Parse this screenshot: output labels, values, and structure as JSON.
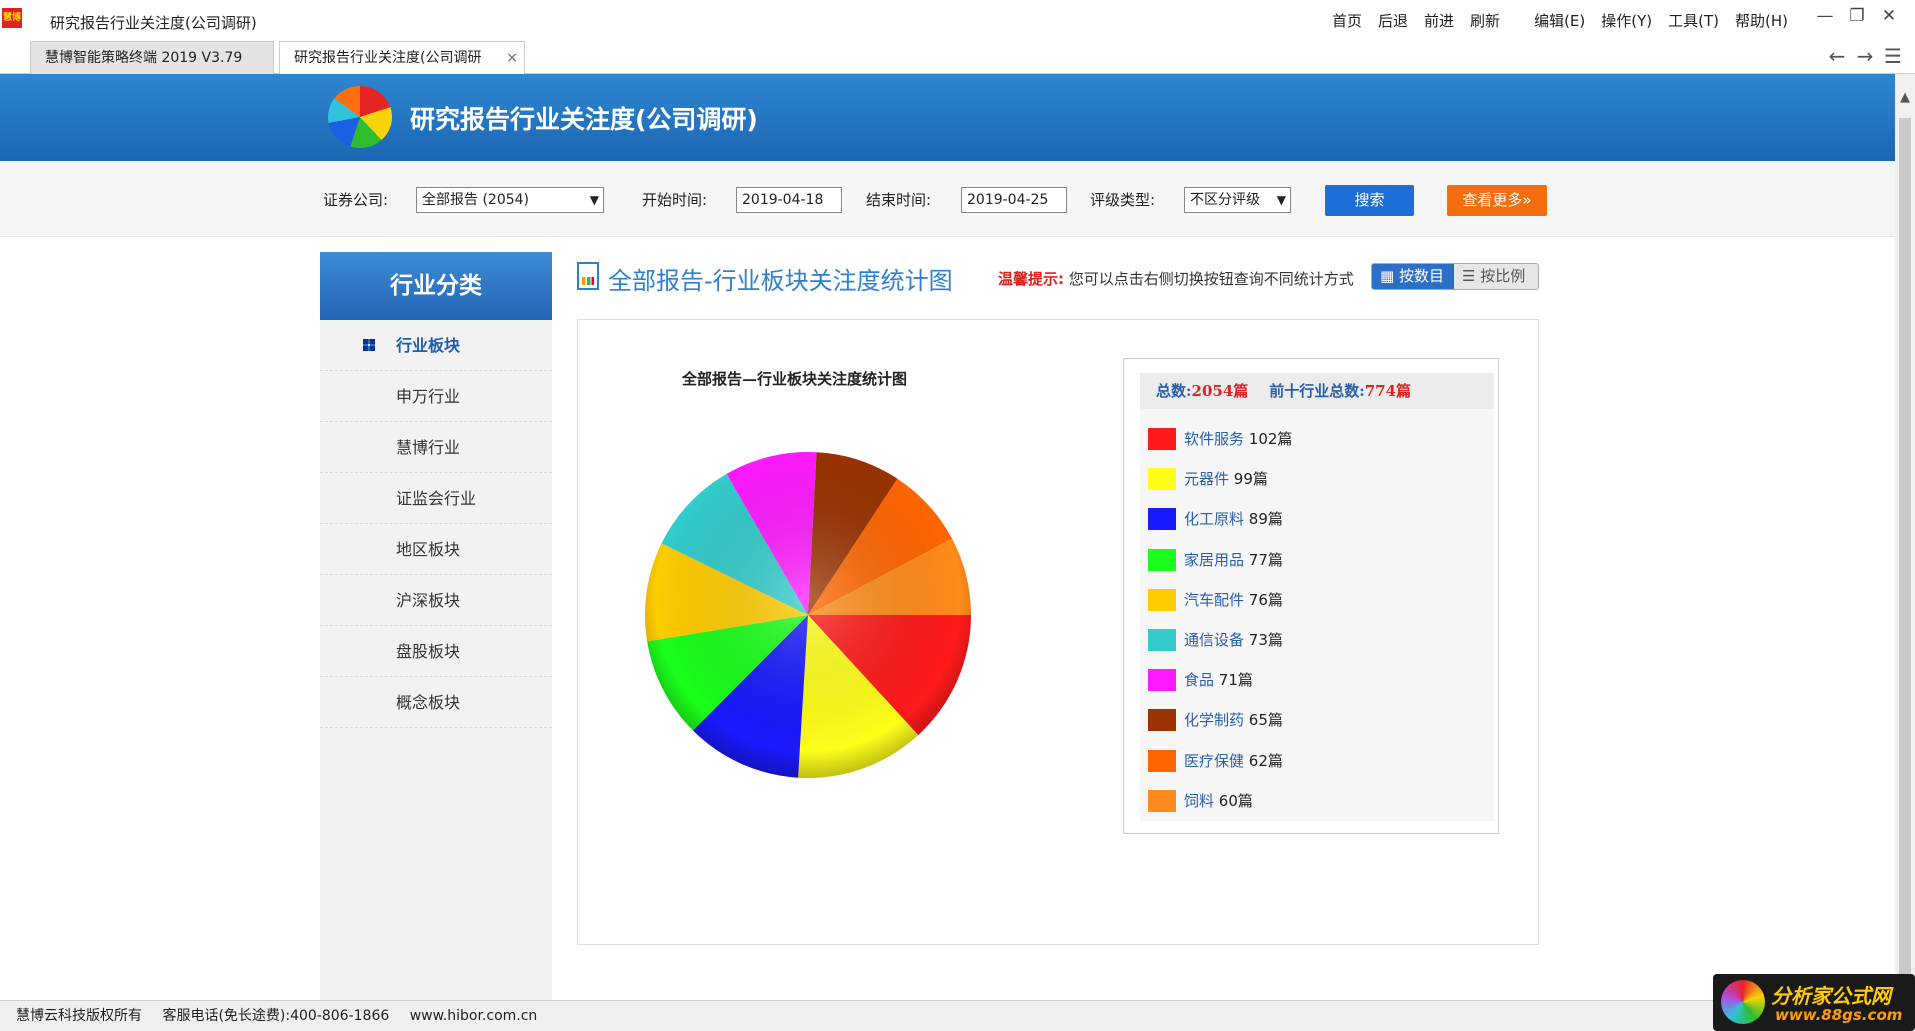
{
  "window": {
    "title": "研究报告行业关注度(公司调研)",
    "logo_text": "慧博",
    "menu": [
      "首页",
      "后退",
      "前进",
      "刷新",
      "编辑(E)",
      "操作(Y)",
      "工具(T)",
      "帮助(H)"
    ],
    "controls": [
      "—",
      "❐",
      "✕"
    ]
  },
  "tabs": [
    {
      "label": "慧博智能策略终端 2019 V3.79"
    },
    {
      "label": "研究报告行业关注度(公司调研",
      "close": "×"
    }
  ],
  "nav_arrows": [
    "←",
    "→",
    "☰"
  ],
  "banner": {
    "title": "研究报告行业关注度(公司调研)"
  },
  "scrollbar": {
    "up": "▲"
  },
  "filters": {
    "broker_label": "证券公司:",
    "broker_value": "全部报告 (2054)",
    "start_label": "开始时间:",
    "start_value": "2019-04-18",
    "end_label": "结束时间:",
    "end_value": "2019-04-25",
    "rating_label": "评级类型:",
    "rating_value": "不区分评级",
    "search_button": "搜索",
    "more_button": "查看更多»",
    "dropdown_arrow": "▼"
  },
  "sidebar": {
    "title": "行业分类",
    "items": [
      {
        "label": "行业板块",
        "active": true
      },
      {
        "label": "申万行业"
      },
      {
        "label": "慧博行业"
      },
      {
        "label": "证监会行业"
      },
      {
        "label": "地区板块"
      },
      {
        "label": "沪深板块"
      },
      {
        "label": "盘股板块"
      },
      {
        "label": "概念板块"
      }
    ]
  },
  "content": {
    "title": "全部报告-行业板块关注度统计图",
    "tip_label": "温馨提示:",
    "tip_text": "您可以点击右侧切换按钮查询不同统计方式",
    "switch_count": "按数目",
    "switch_ratio": "按比例"
  },
  "legend_header": {
    "total_label": "总数:",
    "total_value": "2054篇",
    "top10_label": "前十行业总数:",
    "top10_value": "774篇"
  },
  "chart_data": {
    "type": "pie",
    "title": "全部报告—行业板块关注度统计图",
    "slices": [
      {
        "name": "软件服务",
        "value": 102,
        "label": "102篇",
        "color": "#ff1a1a"
      },
      {
        "name": "元器件",
        "value": 99,
        "label": "99篇",
        "color": "#ffff1a"
      },
      {
        "name": "化工原料",
        "value": 89,
        "label": "89篇",
        "color": "#1a1aff"
      },
      {
        "name": "家居用品",
        "value": 77,
        "label": "77篇",
        "color": "#1aff1a"
      },
      {
        "name": "汽车配件",
        "value": 76,
        "label": "76篇",
        "color": "#ffcc00"
      },
      {
        "name": "通信设备",
        "value": 73,
        "label": "73篇",
        "color": "#33cccc"
      },
      {
        "name": "食品",
        "value": 71,
        "label": "71篇",
        "color": "#ff1aff"
      },
      {
        "name": "化学制药",
        "value": 65,
        "label": "65篇",
        "color": "#993300"
      },
      {
        "name": "医疗保健",
        "value": 62,
        "label": "62篇",
        "color": "#ff6600"
      },
      {
        "name": "饲料",
        "value": 60,
        "label": "60篇",
        "color": "#ff8c1a"
      }
    ]
  },
  "footer": {
    "copyright": "慧博云科技版权所有",
    "phone": "客服电话(免长途费):400-806-1866",
    "website": "www.hibor.com.cn"
  },
  "watermark": {
    "line1": "分析家公式网",
    "line2": "www.88gs.com"
  }
}
